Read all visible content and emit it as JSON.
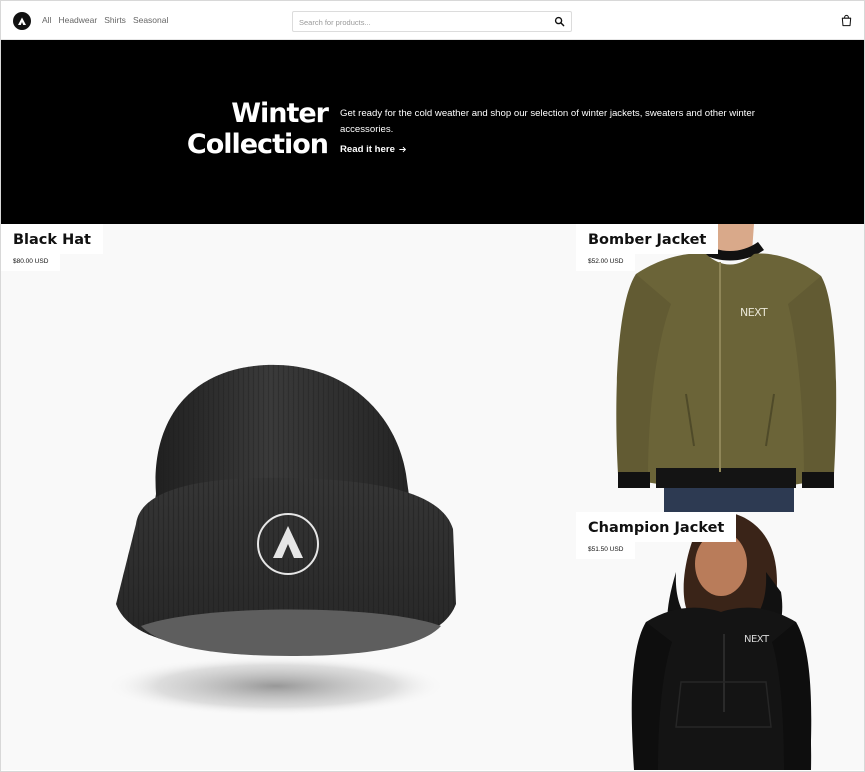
{
  "header": {
    "nav": [
      "All",
      "Headwear",
      "Shirts",
      "Seasonal"
    ],
    "search_placeholder": "Search for products..."
  },
  "hero": {
    "title_line1": "Winter",
    "title_line2": "Collection",
    "description": "Get ready for the cold weather and shop our selection of winter jackets, sweaters and other winter accessories.",
    "link": "Read it here"
  },
  "products": [
    {
      "name": "Black Hat",
      "price": "$80.00 USD"
    },
    {
      "name": "Bomber Jacket",
      "price": "$52.00 USD"
    },
    {
      "name": "Champion Jacket",
      "price": "$51.50 USD"
    }
  ],
  "colors": {
    "hero_bg": "#000000",
    "tile_bg": "#f9f9f9",
    "jacket_olive": "#6b6438",
    "hat_dark": "#2f2f2f"
  }
}
